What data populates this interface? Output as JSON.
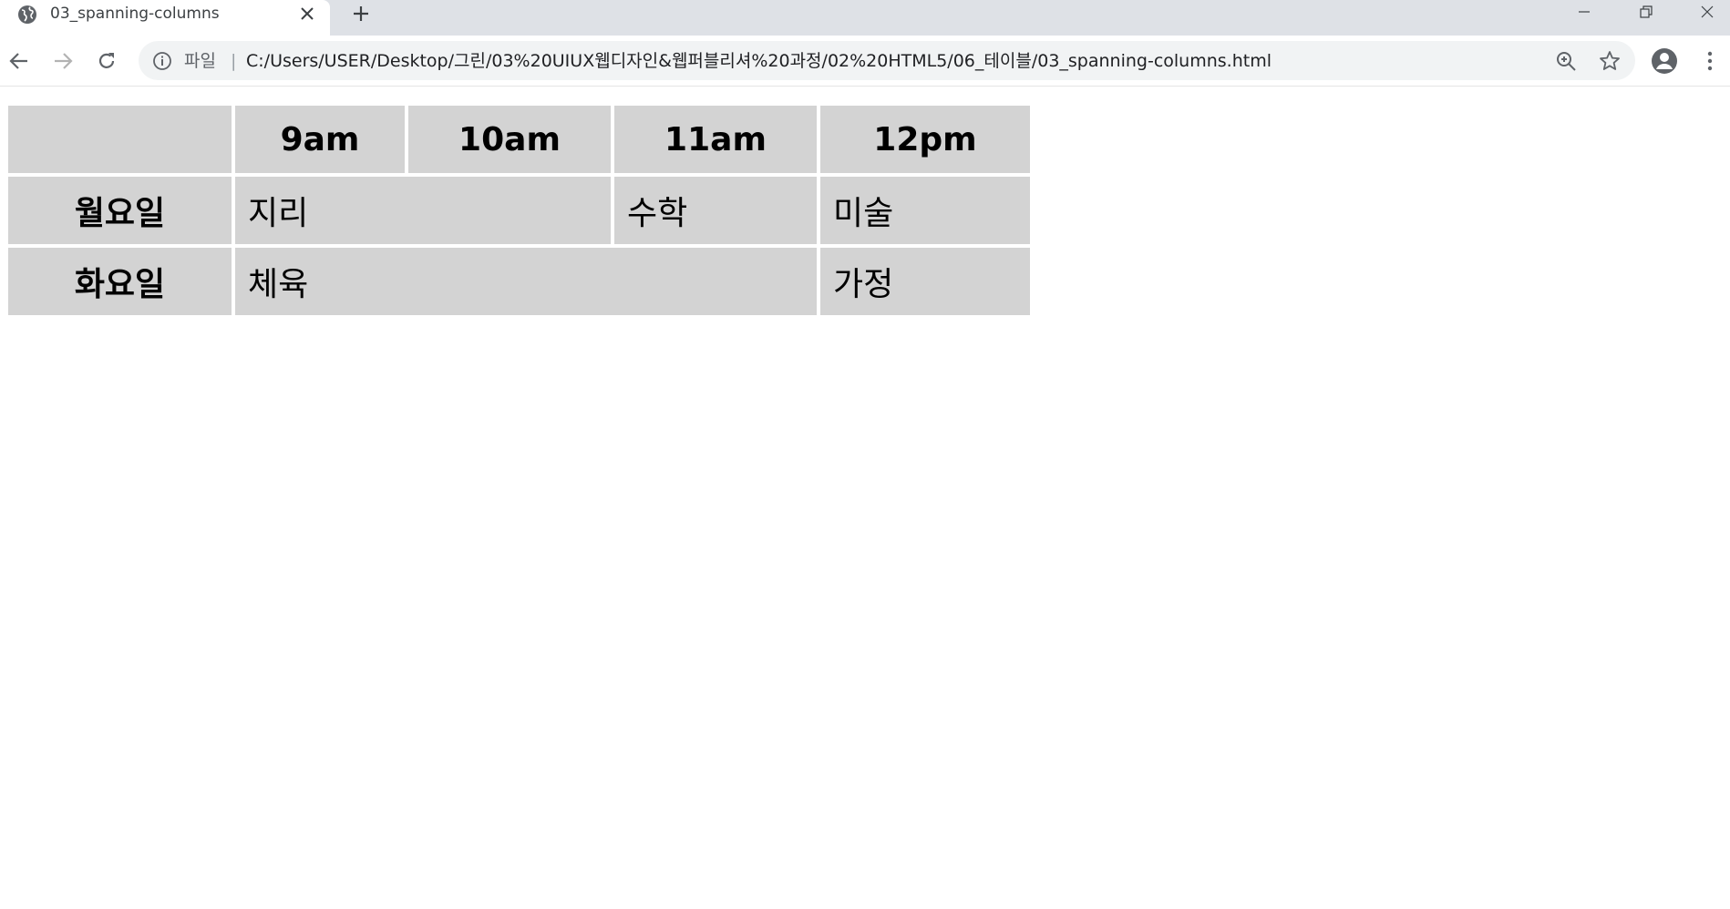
{
  "browser": {
    "tab": {
      "title": "03_spanning-columns"
    },
    "address": {
      "scheme_label": "파일",
      "separator": "|",
      "url": "C:/Users/USER/Desktop/그린/03%20UIUX웹디자인&웹퍼블리셔%20과정/02%20HTML5/06_테이블/03_spanning-columns.html"
    },
    "icons": {
      "favicon": "globe-icon",
      "close": "close-icon",
      "new_tab": "plus-icon",
      "back": "back-arrow-icon",
      "forward": "forward-arrow-icon",
      "reload": "reload-icon",
      "info": "info-icon",
      "zoom": "zoom-in-icon",
      "bookmark": "star-icon",
      "profile": "account-icon",
      "menu": "kebab-menu-icon"
    }
  },
  "timetable": {
    "header": [
      "",
      "9am",
      "10am",
      "11am",
      "12pm"
    ],
    "rows": [
      {
        "day": "월요일",
        "cells": [
          {
            "text": "지리",
            "colspan": 2
          },
          {
            "text": "수학",
            "colspan": 1
          },
          {
            "text": "미술",
            "colspan": 1
          }
        ]
      },
      {
        "day": "화요일",
        "cells": [
          {
            "text": "체육",
            "colspan": 3
          },
          {
            "text": "가정",
            "colspan": 1
          }
        ]
      }
    ],
    "cell_background": "#d3d3d3"
  }
}
